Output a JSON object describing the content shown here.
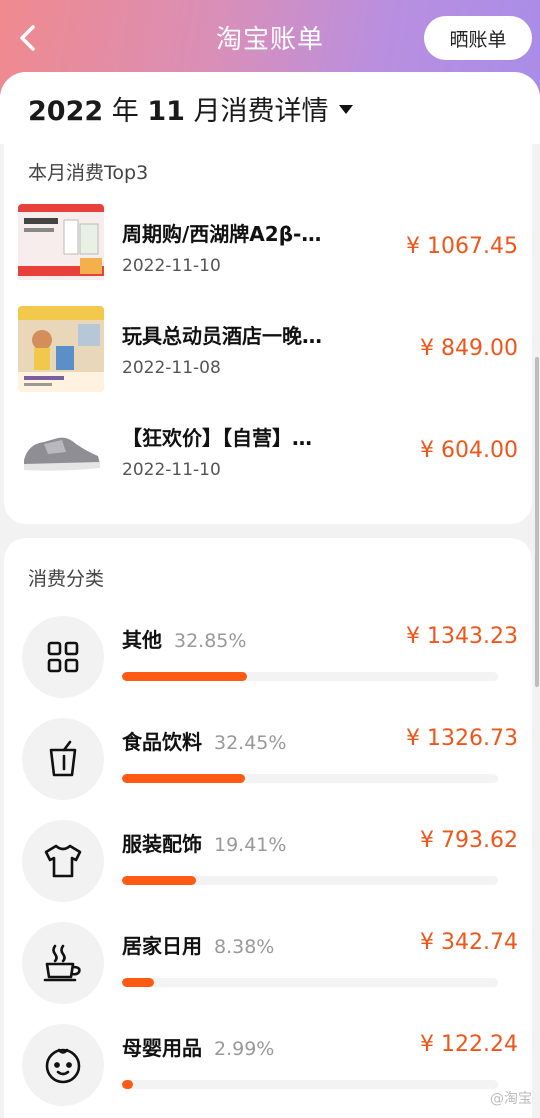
{
  "header": {
    "title": "淘宝账单",
    "share_label": "晒账单"
  },
  "month": {
    "year": "2022",
    "year_unit": "年",
    "month": "11",
    "month_suffix": "月消费详情"
  },
  "top3": {
    "title": "本月消费Top3",
    "items": [
      {
        "name": "周期购/西湖牌A2β-…",
        "date": "2022-11-10",
        "price": "¥ 1067.45"
      },
      {
        "name": "玩具总动员酒店一晚…",
        "date": "2022-11-08",
        "price": "¥ 849.00"
      },
      {
        "name": "【狂欢价】【自营】…",
        "date": "2022-11-10",
        "price": "¥ 604.00"
      }
    ]
  },
  "categories": {
    "title": "消费分类",
    "items": [
      {
        "name": "其他",
        "pct": "32.85%",
        "amount": "¥ 1343.23",
        "share": 0.3285,
        "icon": "grid-icon"
      },
      {
        "name": "食品饮料",
        "pct": "32.45%",
        "amount": "¥ 1326.73",
        "share": 0.3245,
        "icon": "drink-cup-icon"
      },
      {
        "name": "服装配饰",
        "pct": "19.41%",
        "amount": "¥ 793.62",
        "share": 0.1941,
        "icon": "tshirt-icon"
      },
      {
        "name": "居家日用",
        "pct": "8.38%",
        "amount": "¥ 342.74",
        "share": 0.0838,
        "icon": "coffee-mug-icon"
      },
      {
        "name": "母婴用品",
        "pct": "2.99%",
        "amount": "¥ 122.24",
        "share": 0.0299,
        "icon": "baby-face-icon"
      }
    ]
  },
  "watermark": "@淘宝",
  "colors": {
    "accent": "#f0561a",
    "bar": "#ff5a14"
  }
}
